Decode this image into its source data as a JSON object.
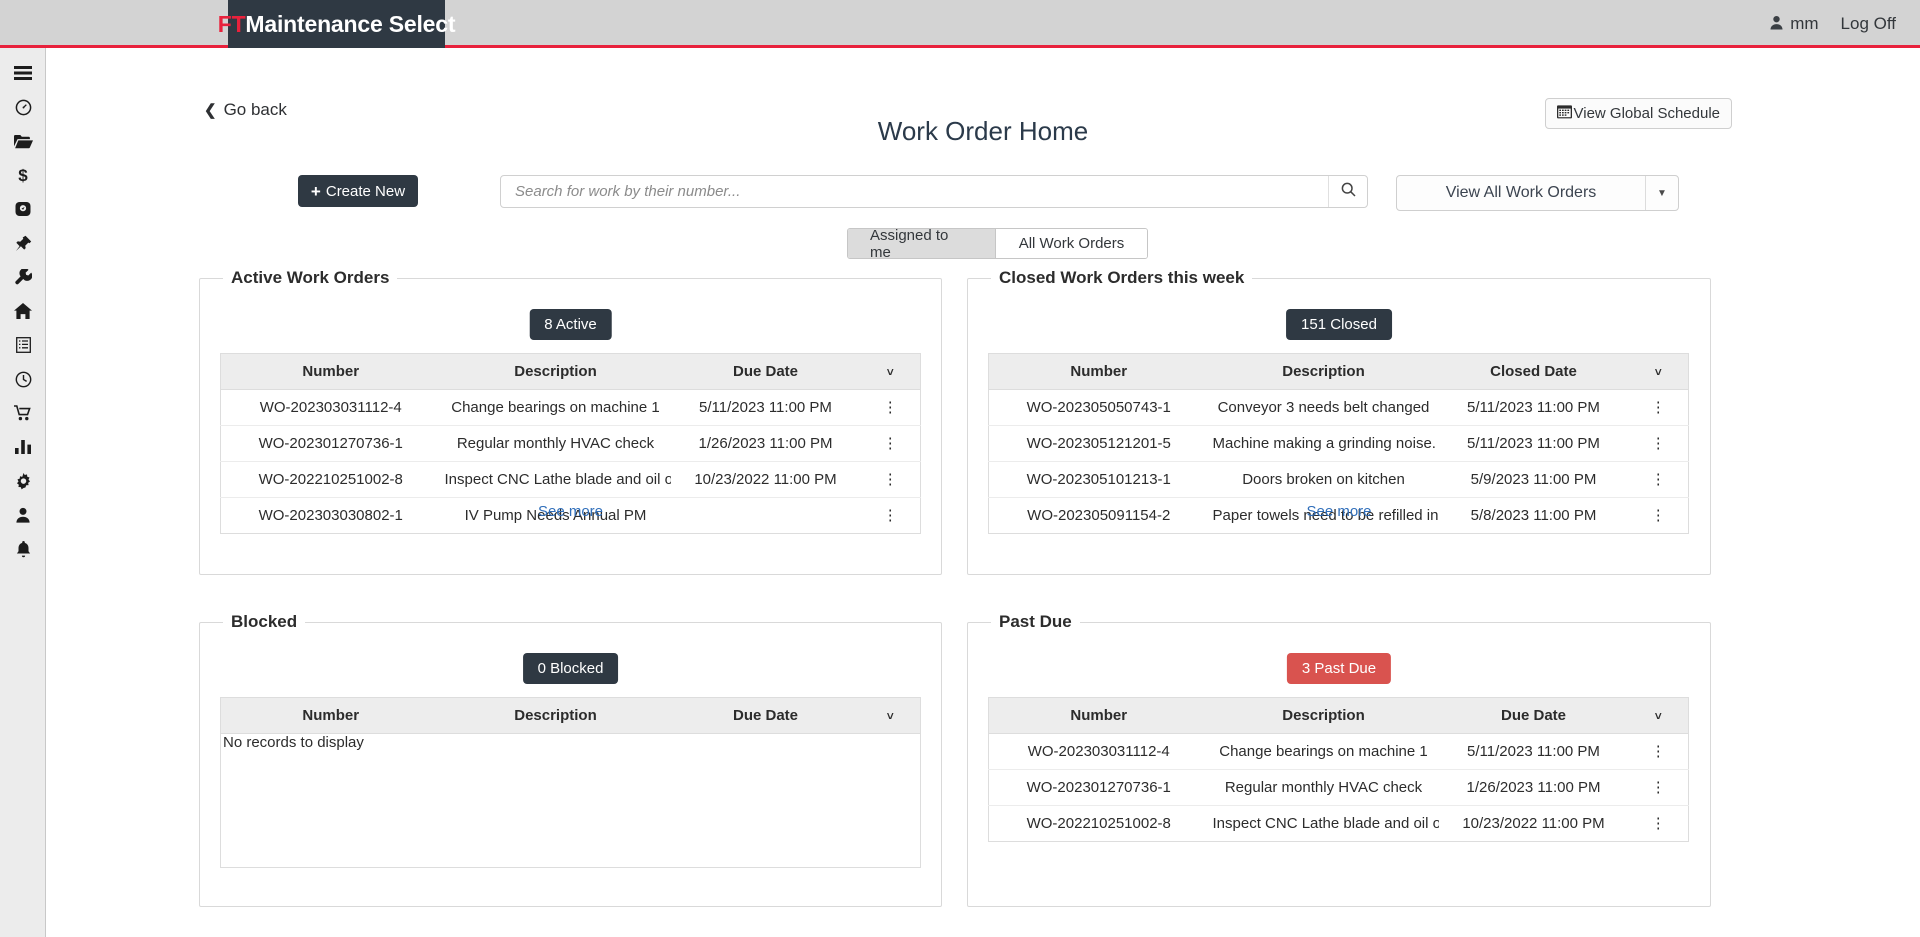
{
  "header": {
    "logo_ft": "FT",
    "logo_rest": "Maintenance Select",
    "user_name": "mm",
    "logoff_label": "Log Off",
    "user_icon": "person-icon"
  },
  "sidebar": {
    "items": [
      {
        "icon": "hamburger-menu-icon",
        "name": "menu"
      },
      {
        "icon": "gauge-icon",
        "name": "dashboard"
      },
      {
        "icon": "folder-open-icon",
        "name": "files"
      },
      {
        "icon": "dollar-icon",
        "name": "costs"
      },
      {
        "icon": "tachometer-icon",
        "name": "meters"
      },
      {
        "icon": "pin-icon",
        "name": "pinned"
      },
      {
        "icon": "wrench-icon",
        "name": "maintenance"
      },
      {
        "icon": "home-icon",
        "name": "home"
      },
      {
        "icon": "list-icon",
        "name": "lists"
      },
      {
        "icon": "clock-icon",
        "name": "schedule"
      },
      {
        "icon": "cart-icon",
        "name": "purchasing"
      },
      {
        "icon": "bar-chart-icon",
        "name": "reports"
      },
      {
        "icon": "gear-icon",
        "name": "settings"
      },
      {
        "icon": "user-icon",
        "name": "account"
      },
      {
        "icon": "bell-icon",
        "name": "notifications"
      }
    ]
  },
  "toolbar": {
    "go_back_label": "Go back",
    "page_title": "Work Order Home",
    "view_global_schedule_label": "View Global Schedule",
    "view_global_schedule_icon": "calendar-icon",
    "create_new_label": "Create New",
    "create_new_icon": "plus-icon",
    "search_placeholder": "Search for work by their number...",
    "search_value": "",
    "search_icon": "magnifier-icon",
    "view_all_label": "View All Work Orders",
    "view_all_caret_icon": "chevron-down-icon"
  },
  "tabs": [
    {
      "label": "Assigned to me",
      "active": true
    },
    {
      "label": "All Work Orders",
      "active": false
    }
  ],
  "panels": {
    "active": {
      "legend": "Active Work Orders",
      "badge": "8 Active",
      "badge_style": "dark",
      "columns": [
        "Number",
        "Description",
        "Due Date"
      ],
      "sort_icon": "chevron-down-icon",
      "rows": [
        {
          "number": "WO-202303031112-4",
          "description": "Change bearings on machine 1",
          "date": "5/11/2023 11:00 PM"
        },
        {
          "number": "WO-202301270736-1",
          "description": "Regular monthly HVAC check",
          "date": "1/26/2023 11:00 PM"
        },
        {
          "number": "WO-202210251002-8",
          "description": "Inspect CNC Lathe blade and oil o",
          "date": "10/23/2022 11:00 PM"
        },
        {
          "number": "WO-202303030802-1",
          "description": "IV Pump Needs Annual PM",
          "date": ""
        }
      ],
      "see_more": "See more",
      "empty_text": ""
    },
    "closed": {
      "legend": "Closed Work Orders this week",
      "badge": "151 Closed",
      "badge_style": "dark",
      "columns": [
        "Number",
        "Description",
        "Closed Date"
      ],
      "sort_icon": "chevron-down-icon",
      "rows": [
        {
          "number": "WO-202305050743-1",
          "description": "Conveyor 3 needs belt changed",
          "date": "5/11/2023 11:00 PM"
        },
        {
          "number": "WO-202305121201-5",
          "description": "Machine making a grinding noise.",
          "date": "5/11/2023 11:00 PM"
        },
        {
          "number": "WO-202305101213-1",
          "description": "Doors broken on kitchen",
          "date": "5/9/2023 11:00 PM"
        },
        {
          "number": "WO-202305091154-2",
          "description": "Paper towels need to be refilled in",
          "date": "5/8/2023 11:00 PM"
        }
      ],
      "see_more": "See more",
      "empty_text": ""
    },
    "blocked": {
      "legend": "Blocked",
      "badge": "0 Blocked",
      "badge_style": "dark",
      "columns": [
        "Number",
        "Description",
        "Due Date"
      ],
      "sort_icon": "chevron-down-icon",
      "rows": [],
      "see_more": "",
      "empty_text": "No records to display"
    },
    "pastdue": {
      "legend": "Past Due",
      "badge": "3 Past Due",
      "badge_style": "red",
      "columns": [
        "Number",
        "Description",
        "Due Date"
      ],
      "sort_icon": "chevron-down-icon",
      "rows": [
        {
          "number": "WO-202303031112-4",
          "description": "Change bearings on machine 1",
          "date": "5/11/2023 11:00 PM"
        },
        {
          "number": "WO-202301270736-1",
          "description": "Regular monthly HVAC check",
          "date": "1/26/2023 11:00 PM"
        },
        {
          "number": "WO-202210251002-8",
          "description": "Inspect CNC Lathe blade and oil o",
          "date": "10/23/2022 11:00 PM"
        }
      ],
      "see_more": "",
      "empty_text": ""
    }
  },
  "colors": {
    "brand_red": "#e8213c",
    "header_dark": "#2f3943",
    "link_blue": "#2f6eba",
    "past_due_red": "#d9534f"
  }
}
